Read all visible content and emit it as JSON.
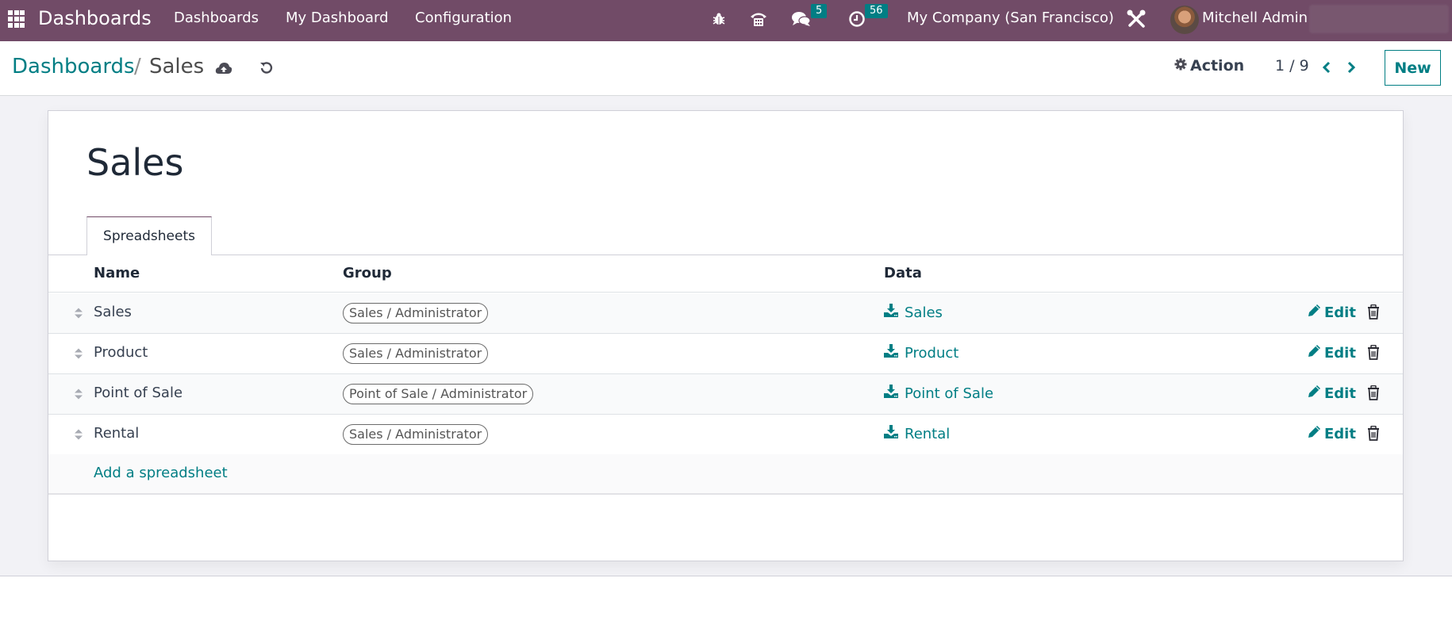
{
  "navbar": {
    "app_name": "Dashboards",
    "menu": [
      "Dashboards",
      "My Dashboard",
      "Configuration"
    ],
    "icons": [
      "bug-icon",
      "phone-icon",
      "chat-icon",
      "clock-icon",
      "tools-icon"
    ],
    "messages_count": "5",
    "activities_count": "56",
    "company": "My Company (San Francisco)",
    "user": "Mitchell Admin"
  },
  "control_panel": {
    "breadcrumb_parent": "Dashboards",
    "breadcrumb_separator": "/",
    "breadcrumb_current": "Sales",
    "action_label": "Action",
    "pager": "1 / 9",
    "new_label": "New"
  },
  "form": {
    "title": "Sales",
    "tab_label": "Spreadsheets",
    "columns": {
      "name": "Name",
      "group": "Group",
      "data": "Data"
    },
    "rows": [
      {
        "name": "Sales",
        "group": "Sales / Administrator",
        "data": "Sales",
        "edit": "Edit"
      },
      {
        "name": "Product",
        "group": "Sales / Administrator",
        "data": "Product",
        "edit": "Edit"
      },
      {
        "name": "Point of Sale",
        "group": "Point of Sale / Administrator",
        "data": "Point of Sale",
        "edit": "Edit"
      },
      {
        "name": "Rental",
        "group": "Sales / Administrator",
        "data": "Rental",
        "edit": "Edit"
      }
    ],
    "add_label": "Add a spreadsheet"
  },
  "colors": {
    "brand": "#714B67",
    "accent": "#017e84",
    "badge": "#017e84"
  }
}
